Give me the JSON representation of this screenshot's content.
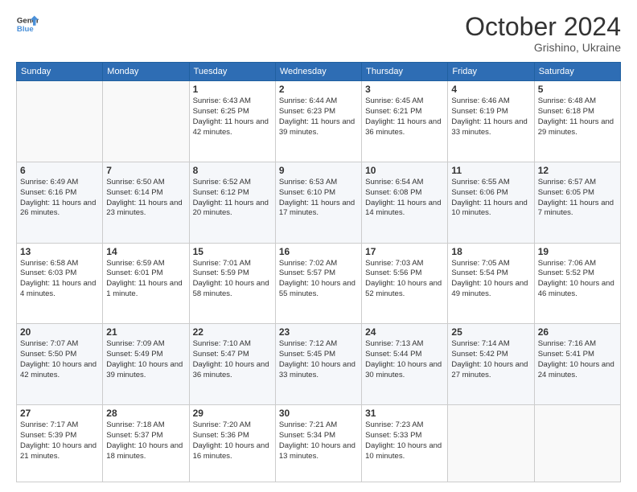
{
  "header": {
    "logo_line1": "General",
    "logo_line2": "Blue",
    "month": "October 2024",
    "location": "Grishino, Ukraine"
  },
  "weekdays": [
    "Sunday",
    "Monday",
    "Tuesday",
    "Wednesday",
    "Thursday",
    "Friday",
    "Saturday"
  ],
  "weeks": [
    [
      {
        "day": "",
        "sunrise": "",
        "sunset": "",
        "daylight": ""
      },
      {
        "day": "",
        "sunrise": "",
        "sunset": "",
        "daylight": ""
      },
      {
        "day": "1",
        "sunrise": "Sunrise: 6:43 AM",
        "sunset": "Sunset: 6:25 PM",
        "daylight": "Daylight: 11 hours and 42 minutes."
      },
      {
        "day": "2",
        "sunrise": "Sunrise: 6:44 AM",
        "sunset": "Sunset: 6:23 PM",
        "daylight": "Daylight: 11 hours and 39 minutes."
      },
      {
        "day": "3",
        "sunrise": "Sunrise: 6:45 AM",
        "sunset": "Sunset: 6:21 PM",
        "daylight": "Daylight: 11 hours and 36 minutes."
      },
      {
        "day": "4",
        "sunrise": "Sunrise: 6:46 AM",
        "sunset": "Sunset: 6:19 PM",
        "daylight": "Daylight: 11 hours and 33 minutes."
      },
      {
        "day": "5",
        "sunrise": "Sunrise: 6:48 AM",
        "sunset": "Sunset: 6:18 PM",
        "daylight": "Daylight: 11 hours and 29 minutes."
      }
    ],
    [
      {
        "day": "6",
        "sunrise": "Sunrise: 6:49 AM",
        "sunset": "Sunset: 6:16 PM",
        "daylight": "Daylight: 11 hours and 26 minutes."
      },
      {
        "day": "7",
        "sunrise": "Sunrise: 6:50 AM",
        "sunset": "Sunset: 6:14 PM",
        "daylight": "Daylight: 11 hours and 23 minutes."
      },
      {
        "day": "8",
        "sunrise": "Sunrise: 6:52 AM",
        "sunset": "Sunset: 6:12 PM",
        "daylight": "Daylight: 11 hours and 20 minutes."
      },
      {
        "day": "9",
        "sunrise": "Sunrise: 6:53 AM",
        "sunset": "Sunset: 6:10 PM",
        "daylight": "Daylight: 11 hours and 17 minutes."
      },
      {
        "day": "10",
        "sunrise": "Sunrise: 6:54 AM",
        "sunset": "Sunset: 6:08 PM",
        "daylight": "Daylight: 11 hours and 14 minutes."
      },
      {
        "day": "11",
        "sunrise": "Sunrise: 6:55 AM",
        "sunset": "Sunset: 6:06 PM",
        "daylight": "Daylight: 11 hours and 10 minutes."
      },
      {
        "day": "12",
        "sunrise": "Sunrise: 6:57 AM",
        "sunset": "Sunset: 6:05 PM",
        "daylight": "Daylight: 11 hours and 7 minutes."
      }
    ],
    [
      {
        "day": "13",
        "sunrise": "Sunrise: 6:58 AM",
        "sunset": "Sunset: 6:03 PM",
        "daylight": "Daylight: 11 hours and 4 minutes."
      },
      {
        "day": "14",
        "sunrise": "Sunrise: 6:59 AM",
        "sunset": "Sunset: 6:01 PM",
        "daylight": "Daylight: 11 hours and 1 minute."
      },
      {
        "day": "15",
        "sunrise": "Sunrise: 7:01 AM",
        "sunset": "Sunset: 5:59 PM",
        "daylight": "Daylight: 10 hours and 58 minutes."
      },
      {
        "day": "16",
        "sunrise": "Sunrise: 7:02 AM",
        "sunset": "Sunset: 5:57 PM",
        "daylight": "Daylight: 10 hours and 55 minutes."
      },
      {
        "day": "17",
        "sunrise": "Sunrise: 7:03 AM",
        "sunset": "Sunset: 5:56 PM",
        "daylight": "Daylight: 10 hours and 52 minutes."
      },
      {
        "day": "18",
        "sunrise": "Sunrise: 7:05 AM",
        "sunset": "Sunset: 5:54 PM",
        "daylight": "Daylight: 10 hours and 49 minutes."
      },
      {
        "day": "19",
        "sunrise": "Sunrise: 7:06 AM",
        "sunset": "Sunset: 5:52 PM",
        "daylight": "Daylight: 10 hours and 46 minutes."
      }
    ],
    [
      {
        "day": "20",
        "sunrise": "Sunrise: 7:07 AM",
        "sunset": "Sunset: 5:50 PM",
        "daylight": "Daylight: 10 hours and 42 minutes."
      },
      {
        "day": "21",
        "sunrise": "Sunrise: 7:09 AM",
        "sunset": "Sunset: 5:49 PM",
        "daylight": "Daylight: 10 hours and 39 minutes."
      },
      {
        "day": "22",
        "sunrise": "Sunrise: 7:10 AM",
        "sunset": "Sunset: 5:47 PM",
        "daylight": "Daylight: 10 hours and 36 minutes."
      },
      {
        "day": "23",
        "sunrise": "Sunrise: 7:12 AM",
        "sunset": "Sunset: 5:45 PM",
        "daylight": "Daylight: 10 hours and 33 minutes."
      },
      {
        "day": "24",
        "sunrise": "Sunrise: 7:13 AM",
        "sunset": "Sunset: 5:44 PM",
        "daylight": "Daylight: 10 hours and 30 minutes."
      },
      {
        "day": "25",
        "sunrise": "Sunrise: 7:14 AM",
        "sunset": "Sunset: 5:42 PM",
        "daylight": "Daylight: 10 hours and 27 minutes."
      },
      {
        "day": "26",
        "sunrise": "Sunrise: 7:16 AM",
        "sunset": "Sunset: 5:41 PM",
        "daylight": "Daylight: 10 hours and 24 minutes."
      }
    ],
    [
      {
        "day": "27",
        "sunrise": "Sunrise: 7:17 AM",
        "sunset": "Sunset: 5:39 PM",
        "daylight": "Daylight: 10 hours and 21 minutes."
      },
      {
        "day": "28",
        "sunrise": "Sunrise: 7:18 AM",
        "sunset": "Sunset: 5:37 PM",
        "daylight": "Daylight: 10 hours and 18 minutes."
      },
      {
        "day": "29",
        "sunrise": "Sunrise: 7:20 AM",
        "sunset": "Sunset: 5:36 PM",
        "daylight": "Daylight: 10 hours and 16 minutes."
      },
      {
        "day": "30",
        "sunrise": "Sunrise: 7:21 AM",
        "sunset": "Sunset: 5:34 PM",
        "daylight": "Daylight: 10 hours and 13 minutes."
      },
      {
        "day": "31",
        "sunrise": "Sunrise: 7:23 AM",
        "sunset": "Sunset: 5:33 PM",
        "daylight": "Daylight: 10 hours and 10 minutes."
      },
      {
        "day": "",
        "sunrise": "",
        "sunset": "",
        "daylight": ""
      },
      {
        "day": "",
        "sunrise": "",
        "sunset": "",
        "daylight": ""
      }
    ]
  ]
}
